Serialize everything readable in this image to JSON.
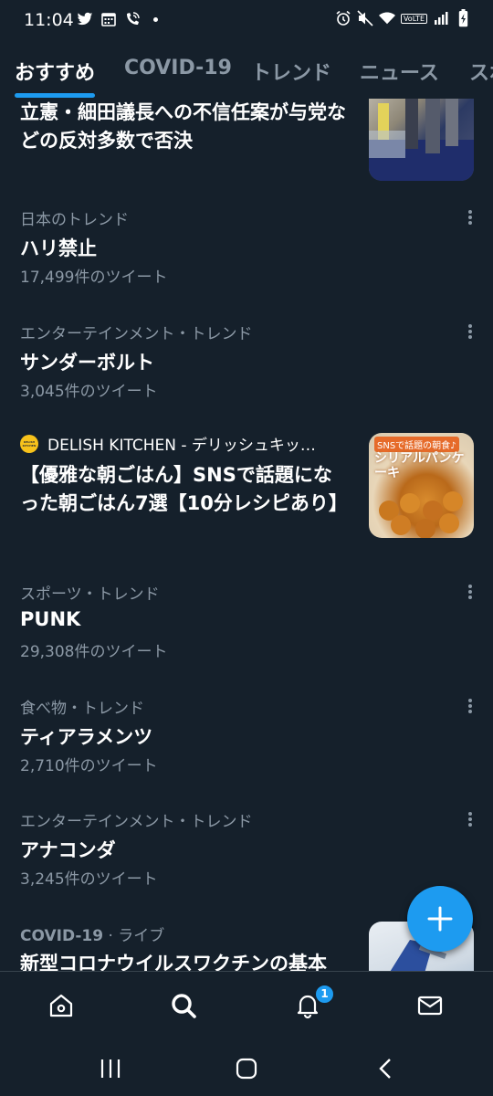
{
  "status_bar": {
    "time": "11:04",
    "left_icons": [
      "twitter-icon",
      "calendar-icon",
      "wifi-calling-icon",
      "notification-dot"
    ],
    "right_icons": [
      "alarm-icon",
      "mute-icon",
      "wifi-icon",
      "volte-icon",
      "signal-icon",
      "battery-charging-icon"
    ],
    "volte_label": "VoLTE"
  },
  "tabs": [
    {
      "label": "おすすめ",
      "active": true
    },
    {
      "label": "COVID-19",
      "active": false
    },
    {
      "label": "トレンド",
      "active": false
    },
    {
      "label": "ニュース",
      "active": false
    },
    {
      "label": "スポ",
      "active": false
    }
  ],
  "feed": {
    "top_news": {
      "title": "立憲・細田議長への不信任案が与党などの反対多数で否決"
    },
    "trends": [
      {
        "category": "日本のトレンド",
        "title": "ハリ禁止",
        "count": "17,499件のツイート"
      },
      {
        "category": "エンターテインメント・トレンド",
        "title": "サンダーボルト",
        "count": "3,045件のツイート"
      }
    ],
    "promo": {
      "source": "DELISH KITCHEN - デリッシュキッ…",
      "logo_text": "DELISH KITCHEN",
      "title": "【優雅な朝ごはん】SNSで話題になった朝ごはん7選【10分レシピあり】",
      "thumb_caption_1": "SNSで話題の朝食♪",
      "thumb_caption_2": "シリアルパンケーキ"
    },
    "trends2": [
      {
        "category": "スポーツ・トレンド",
        "title": "PUNK",
        "count": "29,308件のツイート"
      },
      {
        "category": "食べ物・トレンド",
        "title": "ティアラメンツ",
        "count": "2,710件のツイート"
      },
      {
        "category": "エンターテインメント・トレンド",
        "title": "アナコンダ",
        "count": "3,245件のツイート"
      }
    ],
    "live": {
      "category_strong": "COVID-19",
      "category_rest": " · ライブ",
      "title": "新型コロナウイルスワクチンの基本"
    }
  },
  "bottom_nav": {
    "items": [
      "home-icon",
      "search-icon",
      "notifications-icon",
      "messages-icon"
    ],
    "notification_badge": "1"
  },
  "system_nav": [
    "recent-apps-icon",
    "home-button-icon",
    "back-icon"
  ],
  "colors": {
    "background": "#15202b",
    "accent": "#1d9bf0",
    "secondary_text": "#8b98a5",
    "divider": "#38444d"
  }
}
